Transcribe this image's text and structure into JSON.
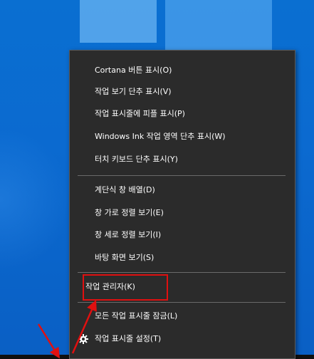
{
  "colors": {
    "desktop_background": "#0b6ad0",
    "menu_background": "#2b2b2b",
    "menu_text": "#ffffff",
    "separator": "#6a6a6a",
    "annotation_red": "#e01010"
  },
  "context_menu": {
    "items": [
      {
        "label": "Cortana 버튼 표시(O)"
      },
      {
        "label": "작업 보기 단추 표시(V)"
      },
      {
        "label": "작업 표시줄에 피플 표시(P)"
      },
      {
        "label": "Windows Ink 작업 영역 단추 표시(W)"
      },
      {
        "label": "터치 키보드 단추 표시(Y)"
      },
      {
        "label": "계단식 창 배열(D)"
      },
      {
        "label": "창 가로 정렬 보기(E)"
      },
      {
        "label": "창 세로 정렬 보기(I)"
      },
      {
        "label": "바탕 화면 보기(S)"
      },
      {
        "label": "작업 관리자(K)"
      },
      {
        "label": "모든 작업 표시줄 잠금(L)"
      },
      {
        "label": "작업 표시줄 설정(T)",
        "icon": "gear-icon"
      }
    ]
  }
}
